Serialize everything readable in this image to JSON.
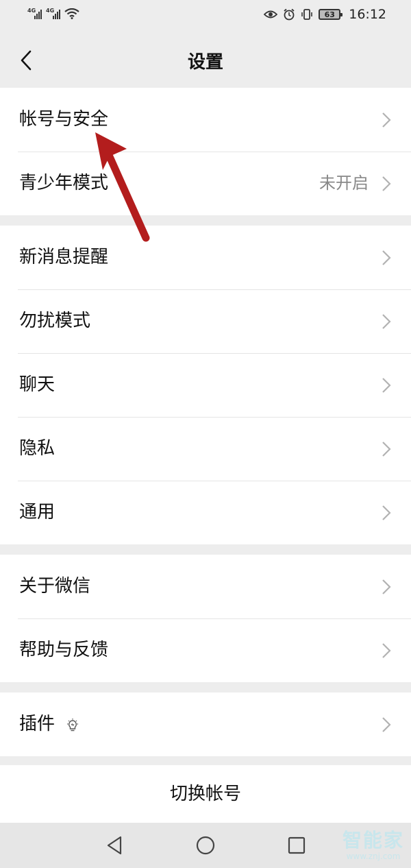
{
  "status_bar": {
    "signal1": "4G",
    "signal2": "4G",
    "battery": "63",
    "time": "16:12"
  },
  "header": {
    "title": "设置"
  },
  "groups": [
    {
      "items": [
        {
          "label": "帐号与安全",
          "value": ""
        },
        {
          "label": "青少年模式",
          "value": "未开启"
        }
      ]
    },
    {
      "items": [
        {
          "label": "新消息提醒"
        },
        {
          "label": "勿扰模式"
        },
        {
          "label": "聊天"
        },
        {
          "label": "隐私"
        },
        {
          "label": "通用"
        }
      ]
    },
    {
      "items": [
        {
          "label": "关于微信"
        },
        {
          "label": "帮助与反馈"
        }
      ]
    },
    {
      "items": [
        {
          "label": "插件"
        }
      ]
    }
  ],
  "switch_account": "切换帐号",
  "watermark": {
    "name": "智能家",
    "url": "www.znj.com"
  },
  "colors": {
    "annotation_arrow": "#b31d1d",
    "background": "#ededed"
  }
}
